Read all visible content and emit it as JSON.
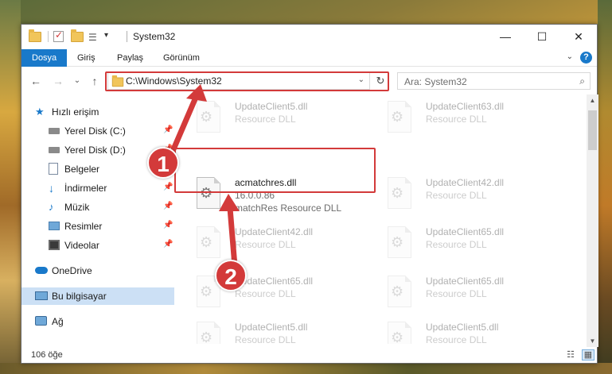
{
  "window": {
    "title": "System32",
    "minimize_glyph": "—",
    "maximize_glyph": "☐",
    "close_glyph": "✕"
  },
  "ribbon": {
    "tabs": [
      {
        "label": "Dosya",
        "active": true
      },
      {
        "label": "Giriş",
        "active": false
      },
      {
        "label": "Paylaş",
        "active": false
      },
      {
        "label": "Görünüm",
        "active": false
      }
    ],
    "help_glyph": "?",
    "collapse_glyph": "⌄"
  },
  "nav": {
    "back_glyph": "←",
    "forward_glyph": "→",
    "recent_glyph": "⌄",
    "up_glyph": "↑",
    "address": "C:\\Windows\\System32",
    "dropdown_glyph": "⌄",
    "refresh_glyph": "↻",
    "search_placeholder": "Ara: System32",
    "search_glyph": "⌕"
  },
  "sidebar": {
    "items": [
      {
        "label": "Hızlı erişim",
        "icon": "star-icon",
        "pinned": false
      },
      {
        "label": "Yerel Disk (C:)",
        "icon": "drive-icon",
        "pinned": true
      },
      {
        "label": "Yerel Disk (D:)",
        "icon": "drive-icon",
        "pinned": true
      },
      {
        "label": "Belgeler",
        "icon": "documents-icon",
        "pinned": true
      },
      {
        "label": "İndirmeler",
        "icon": "download-icon",
        "pinned": true
      },
      {
        "label": "Müzik",
        "icon": "music-icon",
        "pinned": true
      },
      {
        "label": "Resimler",
        "icon": "pictures-icon",
        "pinned": true
      },
      {
        "label": "Videolar",
        "icon": "videos-icon",
        "pinned": true
      },
      {
        "label": "OneDrive",
        "icon": "cloud-icon",
        "pinned": false
      },
      {
        "label": "Bu bilgisayar",
        "icon": "computer-icon",
        "pinned": false,
        "selected": true
      },
      {
        "label": "Ağ",
        "icon": "network-icon",
        "pinned": false
      }
    ],
    "pin_glyph": "📌"
  },
  "files": {
    "focused": {
      "name": "acmatchres.dll",
      "version": "16.0.0.86",
      "description": "matchRes Resource DLL"
    },
    "tiles": [
      {
        "name": "UpdateClient5.dll",
        "type": "Resource DLL"
      },
      {
        "name": "UpdateClient63.dll",
        "type": "Resource DLL"
      },
      {
        "name": "UpdateClient42.dll",
        "type": "Resource DLL"
      },
      {
        "name": "UpdateClient42.dll",
        "type": "Resource DLL"
      },
      {
        "name": "UpdateClient65.dll",
        "type": "Resource DLL"
      },
      {
        "name": "UpdateClient65.dll",
        "type": "Resource DLL"
      },
      {
        "name": "UpdateClient65.dll",
        "type": "Resource DLL"
      },
      {
        "name": "UpdateClient5.dll",
        "type": "Resource DLL"
      },
      {
        "name": "UpdateClient5.dll",
        "type": "Resource DLL"
      }
    ]
  },
  "status": {
    "count": "106 öğe"
  },
  "annotations": {
    "step1": "1",
    "step2": "2",
    "color": "#d33a3a"
  }
}
